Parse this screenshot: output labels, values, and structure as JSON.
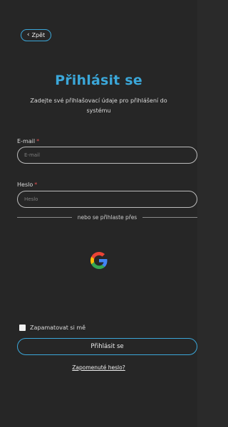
{
  "nav": {
    "back_label": "Zpět"
  },
  "header": {
    "title": "Přihlásit se",
    "subtitle": "Zadejte své přihlašovací údaje pro přihlášení do systému"
  },
  "form": {
    "email": {
      "label": "E-mail",
      "required_mark": "*",
      "placeholder": "E-mail",
      "value": ""
    },
    "password": {
      "label": "Heslo",
      "required_mark": "*",
      "placeholder": "Heslo",
      "value": ""
    },
    "divider_text": "nebo se přihlaste přes",
    "social": {
      "provider_icon": "google-icon"
    },
    "remember_label": "Zapamatovat si mě",
    "submit_label": "Přihlásit se",
    "forgot_label": "Zapomenuté heslo?"
  },
  "colors": {
    "accent": "#3ba7d9",
    "background": "#262626",
    "required": "#e05050"
  }
}
